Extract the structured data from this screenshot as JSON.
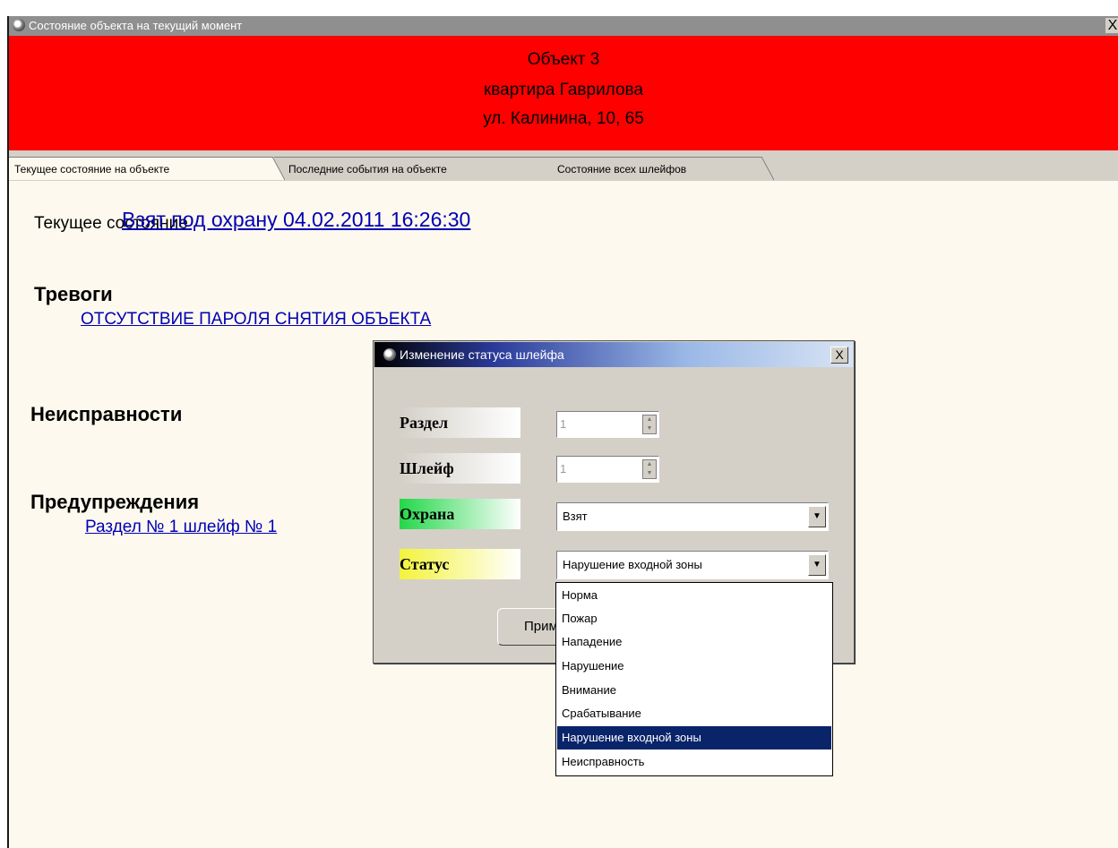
{
  "window": {
    "title": "Состояние объекта на текущий момент",
    "close_glyph": "X"
  },
  "banner": {
    "line1": "Объект   3",
    "line2": "квартира Гаврилова",
    "line3": "ул. Калинина, 10, 65",
    "color": "#ff0000"
  },
  "tabs": [
    {
      "label": "Текущее состояние на объекте",
      "active": true
    },
    {
      "label": "Последние события на объекте",
      "active": false
    },
    {
      "label": "Состояние всех шлейфов",
      "active": false
    }
  ],
  "content": {
    "current_state_label": "Текущее состояние",
    "current_state_value": "Взят под охрану 04.02.2011 16:26:30",
    "alarms_heading": "Тревоги",
    "alarms": [
      "ОТСУТСТВИЕ ПАРОЛЯ СНЯТИЯ ОБЪЕКТА"
    ],
    "faults_heading": "Неисправности",
    "warnings_heading": "Предупреждения",
    "warnings": [
      "Раздел № 1 шлейф № 1"
    ]
  },
  "dialog": {
    "title": "Изменение статуса шлейфа",
    "close_glyph": "X",
    "section_label": "Раздел",
    "section_value": "1",
    "loop_label": "Шлейф",
    "loop_value": "1",
    "guard_label": "Охрана",
    "guard_value": "Взят",
    "status_label": "Статус",
    "status_value": "Нарушение входной зоны",
    "apply_label": "Применить"
  },
  "dropdown": {
    "options": [
      "Норма",
      "Пожар",
      "Нападение",
      "Нарушение",
      "Внимание",
      "Срабатывание",
      "Нарушение входной зоны",
      "Неисправность"
    ],
    "selected": "Нарушение входной зоны",
    "highlight_color": "#0a246a"
  }
}
